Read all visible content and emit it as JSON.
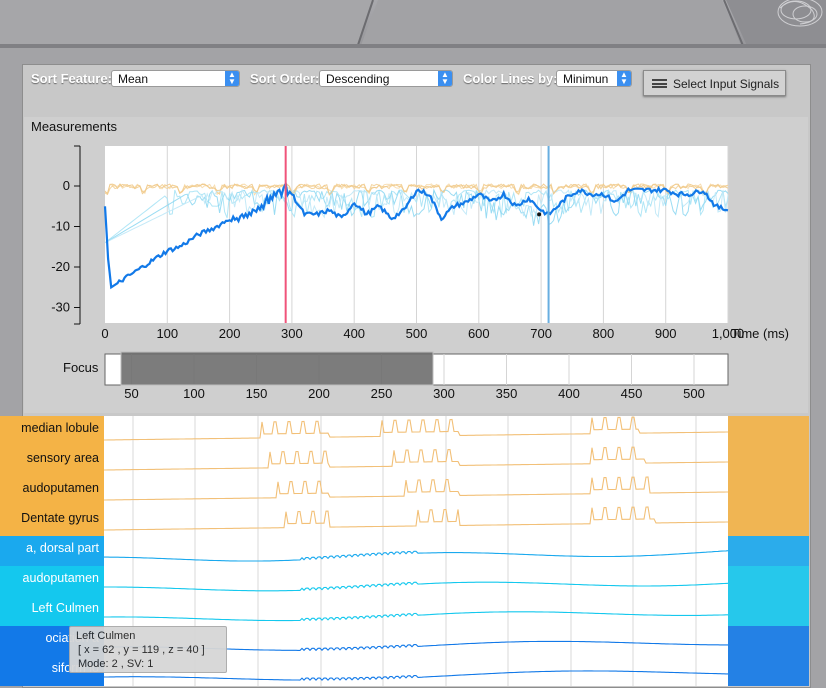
{
  "controls": {
    "sort_feature_label": "Sort Feature:",
    "sort_feature_value": "Mean",
    "sort_order_label": "Sort Order:",
    "sort_order_value": "Descending",
    "color_lines_label": "Color Lines by:",
    "color_lines_value": "Minimun",
    "select_signals_label": "Select Input Signals",
    "select_signals_icon": "list-icon"
  },
  "measurements": {
    "title": "Measurements",
    "x_unit_label": "Time (ms)"
  },
  "focus": {
    "label": "Focus",
    "ticks": [
      "50",
      "100",
      "150",
      "200",
      "250",
      "300",
      "350",
      "400",
      "450",
      "500"
    ],
    "selection_ms": [
      5,
      290
    ]
  },
  "colors": {
    "orange": "#f4b346",
    "orange_line": "#f2c078",
    "blue_light": "#14c8ee",
    "blue_mid": "#1aa9ee",
    "blue_dark": "#1279e8",
    "marker_red": "#f0537a",
    "marker_blue": "#67aee0"
  },
  "signals": [
    {
      "label": "median lobule",
      "group": "orange"
    },
    {
      "label": "sensory area",
      "group": "orange"
    },
    {
      "label": "audoputamen",
      "group": "orange"
    },
    {
      "label": "Dentate gyrus",
      "group": "orange"
    },
    {
      "label": "a, dorsal part",
      "group": "blue_mid"
    },
    {
      "label": "audoputamen",
      "group": "blue_light"
    },
    {
      "label": "Left Culmen",
      "group": "blue_light"
    },
    {
      "label": "ociation a",
      "group": "blue_dark"
    },
    {
      "label": "siform lo",
      "group": "blue_dark"
    }
  ],
  "tooltip": {
    "title": "Left Culmen",
    "coords": "[ x = 62 , y = 119 , z = 40 ]",
    "mode": "Mode: 2 , SV: 1"
  },
  "chart_data": {
    "type": "line",
    "title": "Measurements",
    "xlabel": "Time (ms)",
    "ylabel": "",
    "xlim": [
      0,
      1000
    ],
    "ylim": [
      -33,
      10
    ],
    "x_ticks": [
      0,
      100,
      200,
      300,
      400,
      500,
      600,
      700,
      800,
      900,
      1000
    ],
    "x_tick_labels": [
      "0",
      "100",
      "200",
      "300",
      "400",
      "500",
      "600",
      "700",
      "800",
      "900",
      "1,000"
    ],
    "y_ticks": [
      0,
      -10,
      -20,
      -30
    ],
    "y_tick_labels": [
      "0",
      "-10",
      "-20",
      "-30"
    ],
    "grid": "vertical",
    "markers": [
      {
        "x": 290,
        "color": "red"
      },
      {
        "x": 712,
        "color": "blue"
      }
    ],
    "series": [
      {
        "role": "highlighted",
        "x": [
          0,
          5,
          10,
          20,
          40,
          60,
          80,
          100,
          120,
          150,
          180,
          200,
          220,
          240,
          260,
          280,
          290,
          300,
          320,
          340,
          360,
          380,
          400,
          420,
          440,
          460,
          480,
          500,
          520,
          540,
          560,
          580,
          600,
          620,
          640,
          660,
          680,
          700,
          712,
          720,
          740,
          760,
          780,
          800,
          820,
          840,
          860,
          880,
          900,
          920,
          940,
          960,
          980,
          1000
        ],
        "y": [
          -5,
          -18,
          -25,
          -24,
          -22,
          -20,
          -18,
          -16,
          -15,
          -12,
          -10,
          -8,
          -7,
          -6,
          -3,
          -1,
          0,
          -2,
          -7,
          -7,
          -6,
          -8,
          -4,
          -7,
          -5,
          -8,
          -6,
          -1,
          -2,
          -8,
          -5,
          -4,
          -2,
          -4,
          -2,
          -5,
          -3,
          -6,
          -7,
          -6,
          -3,
          -1,
          -2,
          -2,
          -4,
          -1,
          -1,
          -1,
          -1,
          -2,
          -2,
          -1,
          -5,
          -6
        ]
      }
    ]
  }
}
